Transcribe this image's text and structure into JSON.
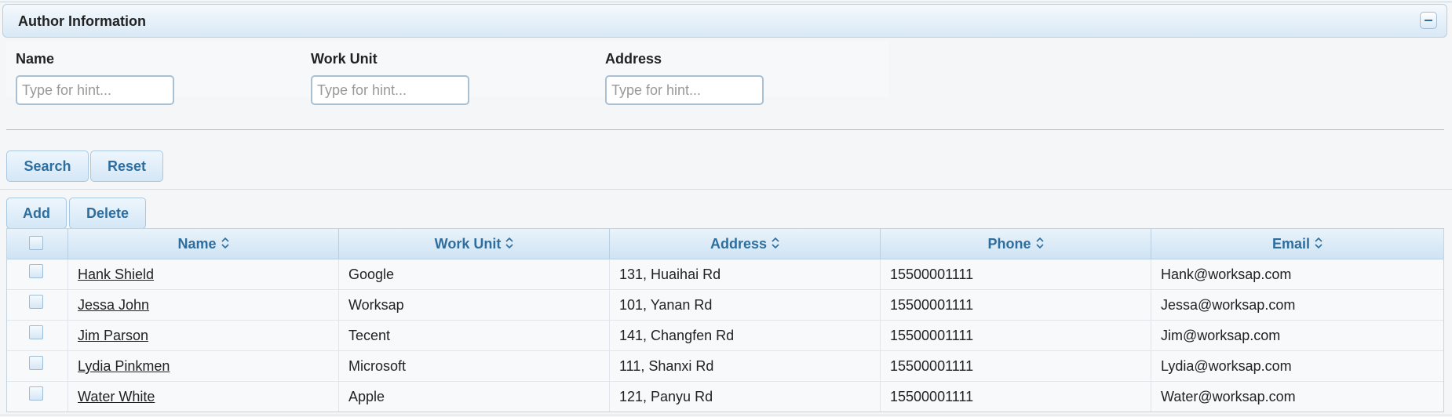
{
  "header": {
    "title": "Author Information",
    "collapse_icon": "minus-icon"
  },
  "search_form": {
    "fields": [
      {
        "label": "Name",
        "placeholder": "Type for hint...",
        "value": ""
      },
      {
        "label": "Work Unit",
        "placeholder": "Type for hint...",
        "value": ""
      },
      {
        "label": "Address",
        "placeholder": "Type for hint...",
        "value": ""
      }
    ],
    "search_label": "Search",
    "reset_label": "Reset"
  },
  "toolbar": {
    "add_label": "Add",
    "delete_label": "Delete"
  },
  "table": {
    "columns": [
      "Name",
      "Work Unit",
      "Address",
      "Phone",
      "Email"
    ],
    "sort_icon": "sort-up-down-icon",
    "rows": [
      {
        "name": "Hank Shield",
        "work_unit": "Google",
        "address": "131, Huaihai Rd",
        "phone": "15500001111",
        "email": "Hank@worksap.com",
        "checked": false
      },
      {
        "name": "Jessa John",
        "work_unit": "Worksap",
        "address": "101, Yanan Rd",
        "phone": "15500001111",
        "email": "Jessa@worksap.com",
        "checked": false
      },
      {
        "name": "Jim Parson",
        "work_unit": "Tecent",
        "address": "141, Changfen Rd",
        "phone": "15500001111",
        "email": "Jim@worksap.com",
        "checked": false
      },
      {
        "name": "Lydia Pinkmen",
        "work_unit": "Microsoft",
        "address": "111, Shanxi Rd",
        "phone": "15500001111",
        "email": "Lydia@worksap.com",
        "checked": false
      },
      {
        "name": "Water White",
        "work_unit": "Apple",
        "address": "121, Panyu Rd",
        "phone": "15500001111",
        "email": "Water@worksap.com",
        "checked": false
      }
    ]
  },
  "colors": {
    "accent": "#2e6e9e",
    "border": "#b8cfe2",
    "header_bg": "#d9e9f6"
  }
}
